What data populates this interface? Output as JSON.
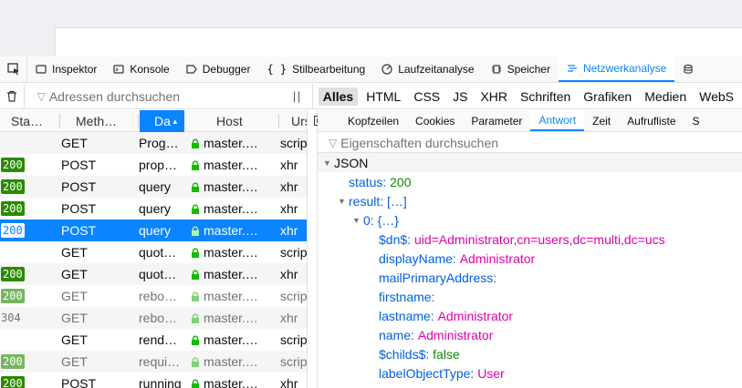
{
  "toolbar": {
    "tabs": [
      {
        "icon": "inspector-icon",
        "label": "Inspektor"
      },
      {
        "icon": "console-icon",
        "label": "Konsole"
      },
      {
        "icon": "debugger-icon",
        "label": "Debugger"
      },
      {
        "icon": "style-editor-icon",
        "label": "Stilbearbeitung"
      },
      {
        "icon": "performance-icon",
        "label": "Laufzeitanalyse"
      },
      {
        "icon": "memory-icon",
        "label": "Speicher"
      },
      {
        "icon": "network-icon",
        "label": "Netzwerkanalyse"
      }
    ],
    "active_tab": "Netzwerkanalyse"
  },
  "filter": {
    "placeholder": "Adressen durchsuchen",
    "types": [
      "Alles",
      "HTML",
      "CSS",
      "JS",
      "XHR",
      "Schriften",
      "Grafiken",
      "Medien",
      "WebS"
    ],
    "active_type": "Alles"
  },
  "table": {
    "headers": [
      "Sta…",
      "Meth…",
      "Da",
      "Host",
      "Urs"
    ],
    "sorted_column": "Da",
    "rows": [
      {
        "status": "",
        "method": "GET",
        "file": "Prog…",
        "host": "master.…",
        "type": "scrip",
        "faded": false
      },
      {
        "status": "200",
        "method": "POST",
        "file": "prop…",
        "host": "master.…",
        "type": "xhr",
        "faded": false
      },
      {
        "status": "200",
        "method": "POST",
        "file": "query",
        "host": "master.…",
        "type": "xhr",
        "faded": false
      },
      {
        "status": "200",
        "method": "POST",
        "file": "query",
        "host": "master.…",
        "type": "xhr",
        "faded": false
      },
      {
        "status": "200",
        "method": "POST",
        "file": "query",
        "host": "master.…",
        "type": "xhr",
        "faded": false,
        "selected": true
      },
      {
        "status": "",
        "method": "GET",
        "file": "quot…",
        "host": "master.…",
        "type": "scrip",
        "faded": false
      },
      {
        "status": "200",
        "method": "GET",
        "file": "quot…",
        "host": "master.…",
        "type": "xhr",
        "faded": false
      },
      {
        "status": "200",
        "method": "GET",
        "file": "rebo…",
        "host": "master.…",
        "type": "scrip",
        "faded": true
      },
      {
        "status": "304",
        "method": "GET",
        "file": "rebo…",
        "host": "master.…",
        "type": "xhr",
        "faded": true,
        "plain_status": true
      },
      {
        "status": "",
        "method": "GET",
        "file": "rend…",
        "host": "master.…",
        "type": "scrip",
        "faded": false
      },
      {
        "status": "200",
        "method": "GET",
        "file": "requi…",
        "host": "master.…",
        "type": "scrip",
        "faded": true
      },
      {
        "status": "200",
        "method": "POST",
        "file": "running",
        "host": "master.…",
        "type": "xhr",
        "faded": false
      }
    ]
  },
  "detail": {
    "tabs": [
      "Kopfzeilen",
      "Cookies",
      "Parameter",
      "Antwort",
      "Zeit",
      "Aufrufliste",
      "S"
    ],
    "active_tab": "Antwort",
    "filter_placeholder": "Eigenschaften durchsuchen",
    "section": "JSON",
    "status_key": "status:",
    "status_val": "200",
    "result_key": "result:",
    "result_val": "[…]",
    "item_key": "0:",
    "item_val": "{…}",
    "fields": [
      {
        "key": "$dn$:",
        "value": "uid=Administrator,cn=users,dc=multi,dc=ucs",
        "kind": "str"
      },
      {
        "key": "displayName:",
        "value": "Administrator",
        "kind": "str"
      },
      {
        "key": "mailPrimaryAddress:",
        "value": "",
        "kind": "str"
      },
      {
        "key": "firstname:",
        "value": "",
        "kind": "str"
      },
      {
        "key": "lastname:",
        "value": "Administrator",
        "kind": "str"
      },
      {
        "key": "name:",
        "value": "Administrator",
        "kind": "str"
      },
      {
        "key": "$childs$:",
        "value": "false",
        "kind": "bool"
      },
      {
        "key": "labelObjectType:",
        "value": "User",
        "kind": "str"
      }
    ]
  },
  "colors": {
    "accent": "#0a84ff",
    "status_ok": "#2b8a00",
    "json_key": "#0060df",
    "json_string": "#dd00a9",
    "json_number": "#058b00"
  }
}
